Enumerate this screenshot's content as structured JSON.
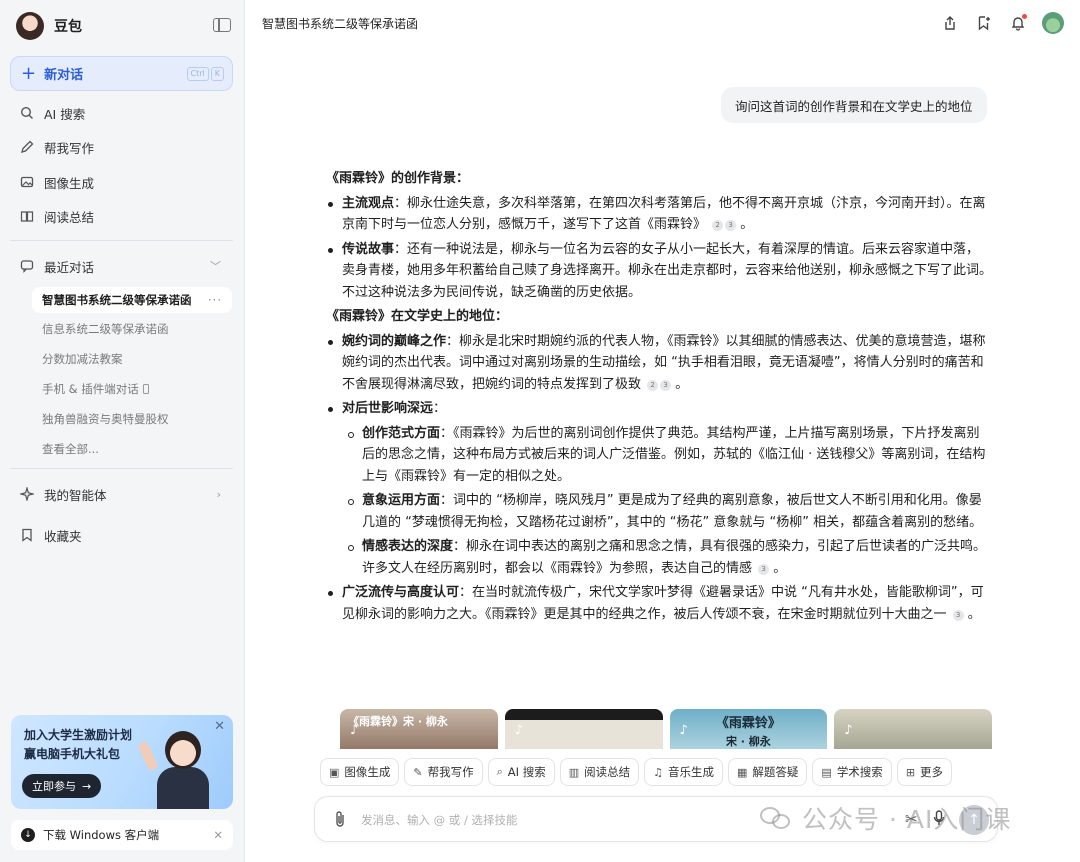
{
  "sidebar": {
    "brand": "豆包",
    "new_chat": "新对话",
    "shortcut": [
      "Ctrl",
      "K"
    ],
    "nav": [
      {
        "label": "AI 搜索",
        "icon": "search-icon"
      },
      {
        "label": "帮我写作",
        "icon": "pen-icon"
      },
      {
        "label": "图像生成",
        "icon": "image-icon"
      },
      {
        "label": "阅读总结",
        "icon": "book-icon"
      }
    ],
    "recent_label": "最近对话",
    "recent": [
      {
        "label": "智慧图书系统二级等保承诺函",
        "active": true
      },
      {
        "label": "信息系统二级等保承诺函"
      },
      {
        "label": "分数加减法教案"
      },
      {
        "label": "手机 & 插件端对话"
      },
      {
        "label": "独角兽融资与奥特曼股权"
      },
      {
        "label": "查看全部..."
      }
    ],
    "agents": "我的智能体",
    "favorites": "收藏夹",
    "promo": {
      "line1": "加入大学生激励计划",
      "line2": "赢电脑手机大礼包",
      "button": "立即参与"
    },
    "download": "下载 Windows 客户端"
  },
  "header": {
    "title": "智慧图书系统二级等保承诺函"
  },
  "user_message": "询问这首词的创作背景和在文学史上的地位",
  "answer": {
    "h1": "《雨霖铃》的创作背景：",
    "b1_title": "主流观点",
    "b1_text": "：柳永仕途失意，多次科举落第，在第四次科考落第后，他不得不离开京城（汴京，今河南开封）。在离京南下时与一位恋人分别，感慨万千，遂写下了这首《雨霖铃》",
    "b2_title": "传说故事",
    "b2_text": "：还有一种说法是，柳永与一位名为云容的女子从小一起长大，有着深厚的情谊。后来云容家道中落，卖身青楼，她用多年积蓄给自己赎了身选择离开。柳永在出走京都时，云容来给他送别，柳永感慨之下写了此词。不过这种说法多为民间传说，缺乏确凿的历史依据。",
    "h2": "《雨霖铃》在文学史上的地位：",
    "b3_title": "婉约词的巅峰之作",
    "b3_text": "：柳永是北宋时期婉约派的代表人物，《雨霖铃》以其细腻的情感表达、优美的意境营造，堪称婉约词的杰出代表。词中通过对离别场景的生动描绘，如 “执手相看泪眼，竟无语凝噎”，将情人分别时的痛苦和不舍展现得淋漓尽致，把婉约词的特点发挥到了极致",
    "b4_title": "对后世影响深远",
    "b4_text": "：",
    "s1_title": "创作范式方面",
    "s1_text": "：《雨霖铃》为后世的离别词创作提供了典范。其结构严谨，上片描写离别场景，下片抒发离别后的思念之情，这种布局方式被后来的词人广泛借鉴。例如，苏轼的《临江仙 · 送钱穆父》等离别词，在结构上与《雨霖铃》有一定的相似之处。",
    "s2_title": "意象运用方面",
    "s2_text": "：词中的 “杨柳岸，晓风残月” 更是成为了经典的离别意象，被后世文人不断引用和化用。像晏几道的 “梦魂惯得无拘检，又踏杨花过谢桥”，其中的 “杨花” 意象就与 “杨柳” 相关，都蕴含着离别的愁绪。",
    "s3_title": "情感表达的深度",
    "s3_text": "：柳永在词中表达的离别之痛和思念之情，具有很强的感染力，引起了后世读者的广泛共鸣。许多文人在经历离别时，都会以《雨霖铃》为参照，表达自己的情感",
    "b5_title": "广泛流传与高度认可",
    "b5_text": "：在当时就流传极广，宋代文学家叶梦得《避暑录话》中说 “凡有井水处，皆能歌柳词”，可见柳永词的影响力之大。《雨霖铃》更是其中的经典之作，被后人传颂不衰，在宋金时期就位列十大曲之一",
    "cite_2": "2",
    "cite_3": "3"
  },
  "thumbs": [
    {
      "title": "《雨霖铃》宋 · 柳永"
    },
    {
      "title": ""
    },
    {
      "title": "《雨霖铃》",
      "subtitle": "宋 · 柳永"
    },
    {
      "title": ""
    }
  ],
  "tools": [
    "图像生成",
    "帮我写作",
    "AI 搜索",
    "阅读总结",
    "音乐生成",
    "解题答疑",
    "学术搜索",
    "更多"
  ],
  "composer": {
    "placeholder": "发消息、输入 @ 或 / 选择技能"
  },
  "watermark": "公众号 · AI入门课"
}
